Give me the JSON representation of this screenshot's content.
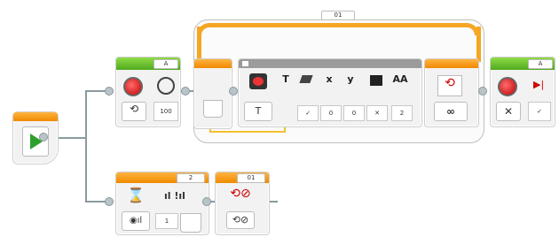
{
  "loop": {
    "label": "01"
  },
  "motor_a": {
    "port": "A",
    "speed": "100"
  },
  "display": {
    "text_icon": "T",
    "param_t": "T",
    "param_clear": "✓",
    "param_x": "x",
    "param_x_val": "0",
    "param_y": "y",
    "param_y_val": "0",
    "param_color_val": "✕",
    "param_font": "AA",
    "param_font_val": "2"
  },
  "motor_stop": {
    "port": "A",
    "brake": "✓"
  },
  "wait_sound": {
    "port": "2",
    "value": "1"
  },
  "loop_interrupt": {
    "label": "01"
  },
  "colors": {
    "green": "#5cb82a",
    "orange": "#f39200",
    "wire": "#8a9aa0",
    "loop": "#f5a623"
  }
}
